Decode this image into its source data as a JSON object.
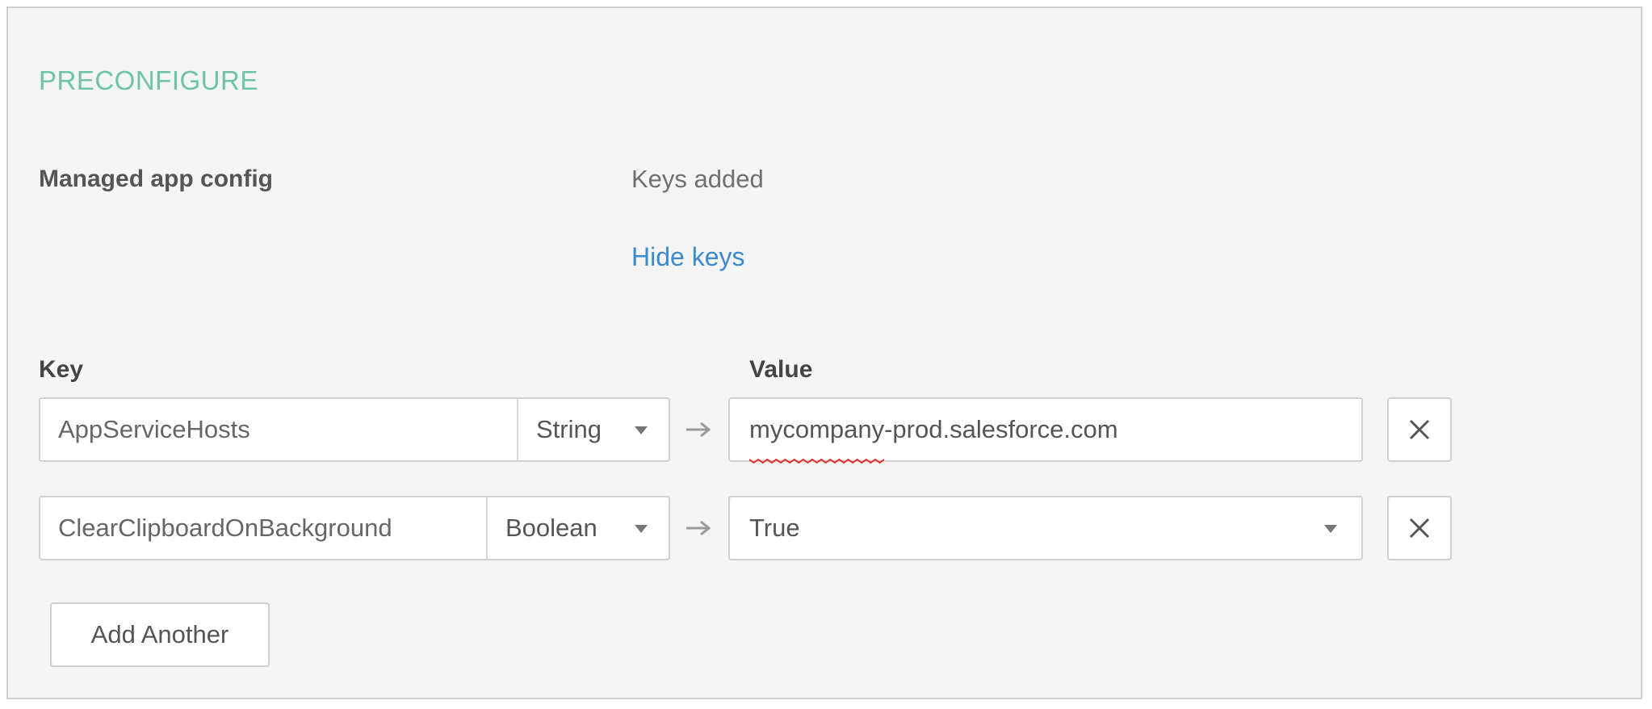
{
  "section": {
    "title": "PRECONFIGURE"
  },
  "managed_config": {
    "label": "Managed app config",
    "status": "Keys added",
    "toggle_link": "Hide keys"
  },
  "table": {
    "key_header": "Key",
    "value_header": "Value",
    "rows": [
      {
        "key": "AppServiceHosts",
        "type": "String",
        "value": "mycompany-prod.salesforce.com",
        "value_misspelled_part": "mycompany",
        "value_rest": "-prod.salesforce.com",
        "value_is_select": false
      },
      {
        "key": "ClearClipboardOnBackground",
        "type": "Boolean",
        "value": "True",
        "value_is_select": true
      }
    ]
  },
  "actions": {
    "add_another": "Add Another"
  },
  "icons": {
    "type_dropdown": "chevron-down-icon",
    "row_arrow": "arrow-right-icon",
    "remove_row": "close-icon"
  },
  "colors": {
    "section_title": "#6ec4a7",
    "link": "#3a8ad0",
    "panel_bg": "#f5f5f5",
    "spellcheck": "#e03030"
  }
}
